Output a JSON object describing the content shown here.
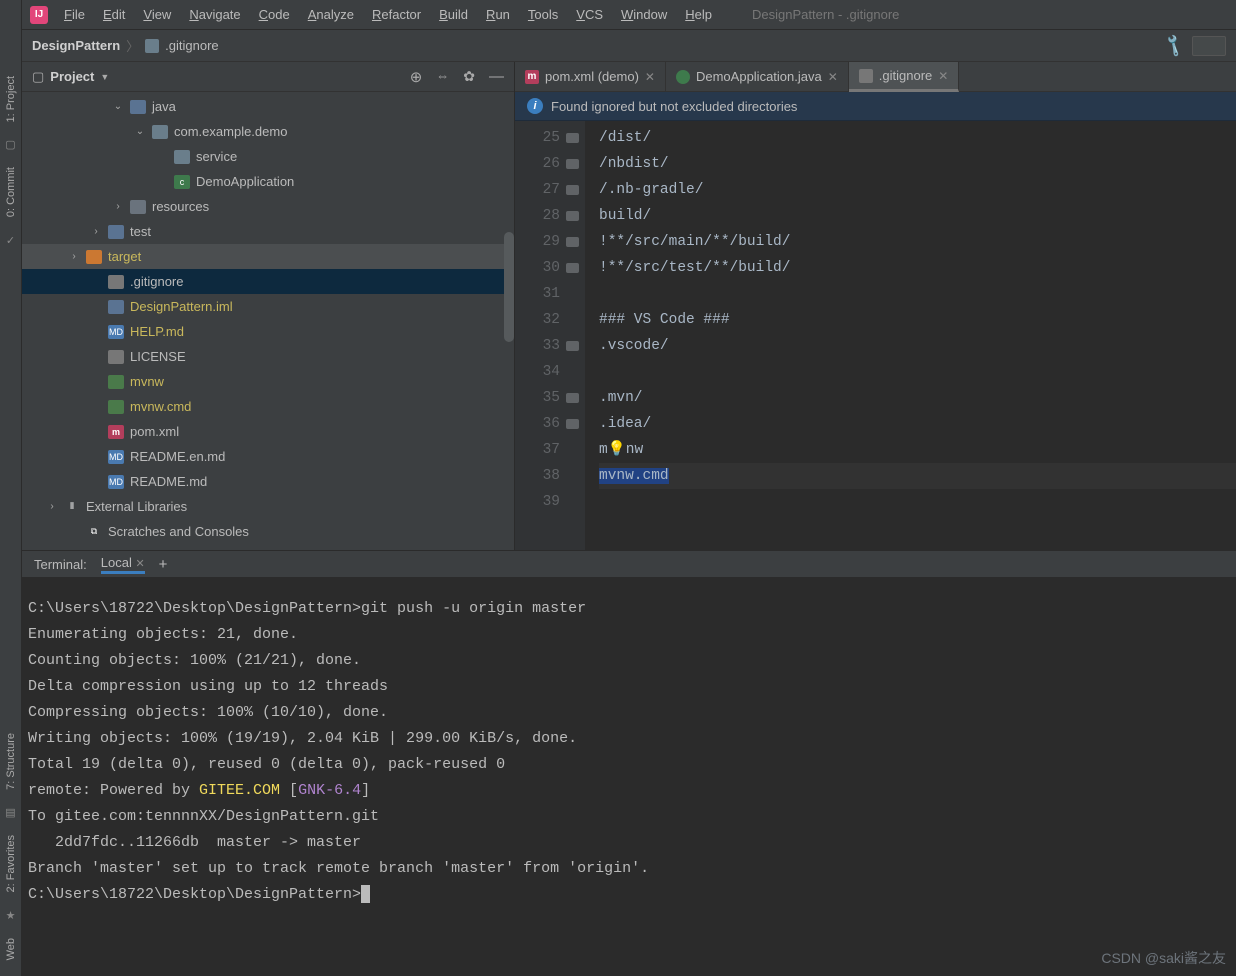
{
  "menubar": {
    "items": [
      "File",
      "Edit",
      "View",
      "Navigate",
      "Code",
      "Analyze",
      "Refactor",
      "Build",
      "Run",
      "Tools",
      "VCS",
      "Window",
      "Help"
    ],
    "title": "DesignPattern - .gitignore"
  },
  "breadcrumb": {
    "project": "DesignPattern",
    "file": ".gitignore"
  },
  "projectPane": {
    "label": "Project",
    "tree": [
      {
        "d": 3,
        "t": "java",
        "a": "v",
        "i": "fld-blue"
      },
      {
        "d": 4,
        "t": "com.example.demo",
        "a": "v",
        "i": "pkg"
      },
      {
        "d": 5,
        "t": "service",
        "i": "pkg"
      },
      {
        "d": 5,
        "t": "DemoApplication",
        "i": "class-i"
      },
      {
        "d": 3,
        "t": "resources",
        "a": ">",
        "i": "fld-gray"
      },
      {
        "d": 2,
        "t": "test",
        "a": ">",
        "i": "fld-blue"
      },
      {
        "d": 1,
        "t": "target",
        "a": ">",
        "i": "fld-orng",
        "y": 1,
        "tsel": 1
      },
      {
        "d": 2,
        "t": ".gitignore",
        "i": "txt-i",
        "sel": 1
      },
      {
        "d": 2,
        "t": "DesignPattern.iml",
        "i": "file-i",
        "y": 1
      },
      {
        "d": 2,
        "t": "HELP.md",
        "i": "md-i",
        "y": 1
      },
      {
        "d": 2,
        "t": "LICENSE",
        "i": "txt-i"
      },
      {
        "d": 2,
        "t": "mvnw",
        "i": "sh-i",
        "y": 1
      },
      {
        "d": 2,
        "t": "mvnw.cmd",
        "i": "sh-i",
        "y": 1
      },
      {
        "d": 2,
        "t": "pom.xml",
        "i": "m-i"
      },
      {
        "d": 2,
        "t": "README.en.md",
        "i": "md-i"
      },
      {
        "d": 2,
        "t": "README.md",
        "i": "md-i"
      },
      {
        "d": 0,
        "t": "External Libraries",
        "a": ">",
        "i": "lib-i"
      },
      {
        "d": 1,
        "t": "Scratches and Consoles",
        "i": "scr-i"
      }
    ]
  },
  "editorTabs": [
    {
      "name": "pom.xml (demo)",
      "icon": "m-i"
    },
    {
      "name": "DemoApplication.java",
      "icon": "class-i"
    },
    {
      "name": ".gitignore",
      "icon": "txt-i",
      "active": true
    }
  ],
  "banner": "Found ignored but not excluded directories",
  "editor": {
    "start": 25,
    "lines": [
      {
        "t": "/dist/",
        "f": 1
      },
      {
        "t": "/nbdist/",
        "f": 1
      },
      {
        "t": "/.nb-gradle/",
        "f": 1
      },
      {
        "t": "build/",
        "f": 1
      },
      {
        "t": "!**/src/main/**/build/",
        "f": 1
      },
      {
        "t": "!**/src/test/**/build/",
        "f": 1
      },
      {
        "t": ""
      },
      {
        "t": "### VS Code ###"
      },
      {
        "t": ".vscode/",
        "f": 1
      },
      {
        "t": ""
      },
      {
        "t": ".mvn/",
        "f": 1
      },
      {
        "t": ".idea/",
        "f": 1
      },
      {
        "t": "mvnw",
        "bulb": 1
      },
      {
        "t": "mvnw.cmd",
        "curr": 1,
        "hl": 1
      },
      {
        "t": ""
      }
    ]
  },
  "terminalTabs": {
    "label": "Terminal:",
    "tab": "Local"
  },
  "terminal": {
    "lines": [
      [
        {
          "c": "",
          "t": "C:\\Users\\18722\\Desktop\\DesignPattern>git push -u origin master"
        }
      ],
      [
        {
          "c": "",
          "t": "Enumerating objects: 21, done."
        }
      ],
      [
        {
          "c": "",
          "t": "Counting objects: 100% (21/21), done."
        }
      ],
      [
        {
          "c": "",
          "t": "Delta compression using up to 12 threads"
        }
      ],
      [
        {
          "c": "",
          "t": "Compressing objects: 100% (10/10), done."
        }
      ],
      [
        {
          "c": "",
          "t": "Writing objects: 100% (19/19), 2.04 KiB | 299.00 KiB/s, done."
        }
      ],
      [
        {
          "c": "",
          "t": "Total 19 (delta 0), reused 0 (delta 0), pack-reused 0"
        }
      ],
      [
        {
          "c": "",
          "t": "remote: Powered by "
        },
        {
          "c": "y",
          "t": "GITEE.COM"
        },
        {
          "c": "",
          "t": " ["
        },
        {
          "c": "p",
          "t": "GNK-6.4"
        },
        {
          "c": "",
          "t": "]"
        }
      ],
      [
        {
          "c": "",
          "t": "To gitee.com:tennnnXX/DesignPattern.git"
        }
      ],
      [
        {
          "c": "",
          "t": "   2dd7fdc..11266db  master -> master"
        }
      ],
      [
        {
          "c": "",
          "t": "Branch 'master' set up to track remote branch 'master' from 'origin'."
        }
      ],
      [
        {
          "c": "",
          "t": ""
        }
      ],
      [
        {
          "c": "",
          "t": "C:\\Users\\18722\\Desktop\\DesignPattern>"
        },
        {
          "c": "cur",
          "t": ""
        }
      ]
    ]
  },
  "leftStrip": [
    "1: Project",
    "0: Commit",
    "7: Structure",
    "2: Favorites",
    "Web"
  ],
  "watermark": "CSDN @saki酱之友"
}
